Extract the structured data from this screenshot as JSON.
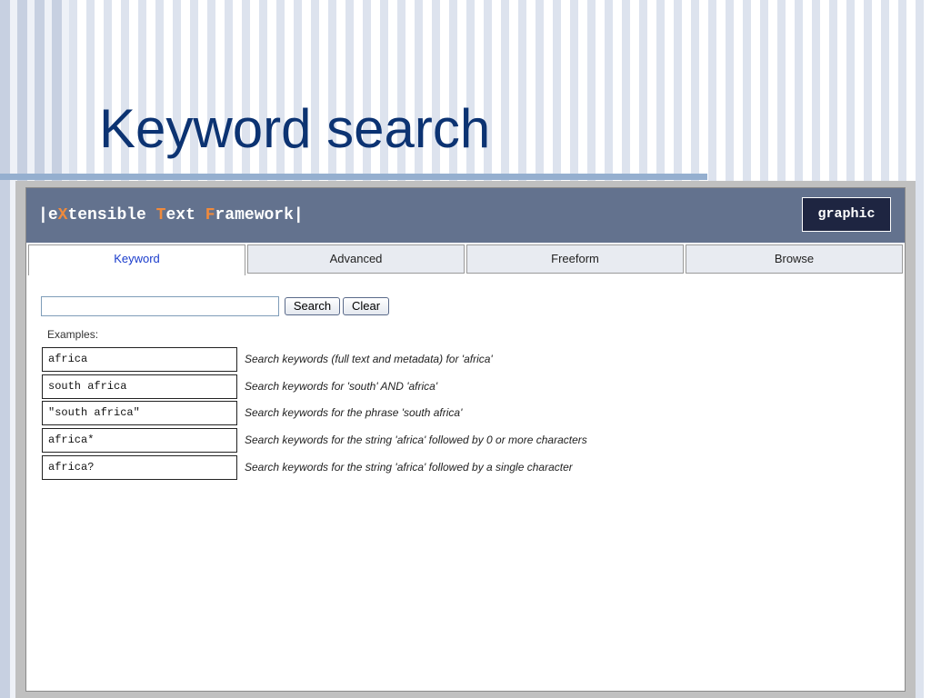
{
  "slide": {
    "title": "Keyword search"
  },
  "app": {
    "logo": {
      "bar_left": "|",
      "e": "e",
      "x": "X",
      "tensible": "tensible ",
      "t": "T",
      "ext": "ext ",
      "f": "F",
      "ramework": "ramework",
      "bar_right": "|"
    },
    "graphic_label": "graphic"
  },
  "tabs": [
    {
      "label": "Keyword",
      "active": true
    },
    {
      "label": "Advanced",
      "active": false
    },
    {
      "label": "Freeform",
      "active": false
    },
    {
      "label": "Browse",
      "active": false
    }
  ],
  "search": {
    "value": "",
    "placeholder": "",
    "search_label": "Search",
    "clear_label": "Clear"
  },
  "examples": {
    "label": "Examples:",
    "items": [
      {
        "query": "africa",
        "description": "Search keywords (full text and metadata) for 'africa'"
      },
      {
        "query": "south africa",
        "description": "Search keywords for 'south' AND 'africa'"
      },
      {
        "query": "\"south africa\"",
        "description": "Search keywords for the phrase 'south africa'"
      },
      {
        "query": "africa*",
        "description": "Search keywords for the string 'africa' followed by 0 or more characters"
      },
      {
        "query": "africa?",
        "description": "Search keywords for the string 'africa' followed by a single character"
      }
    ]
  },
  "colors": {
    "title": "#0c3372",
    "header_bg": "#63728e",
    "logo_accent": "#f08a3c",
    "graphic_button_bg": "#1e2541",
    "active_tab_text": "#1a3ccc"
  }
}
